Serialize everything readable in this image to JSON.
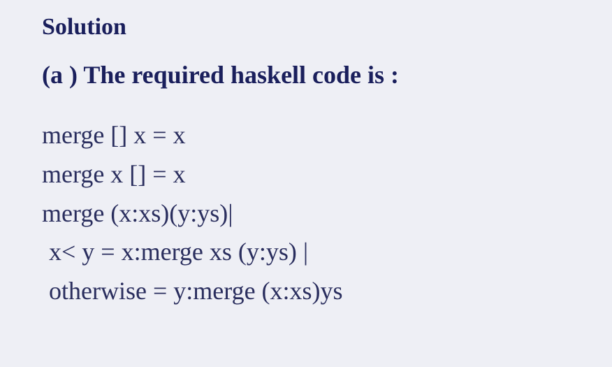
{
  "heading": {
    "solution": "Solution",
    "part_a": "(a )  The required haskell code is :"
  },
  "code": {
    "line1": "merge [] x = x",
    "line2": "merge x [] = x",
    "line3": "merge (x:xs)(y:ys)|",
    "line4": " x< y = x:merge xs (y:ys) |",
    "line5": " otherwise = y:merge (x:xs)ys"
  }
}
